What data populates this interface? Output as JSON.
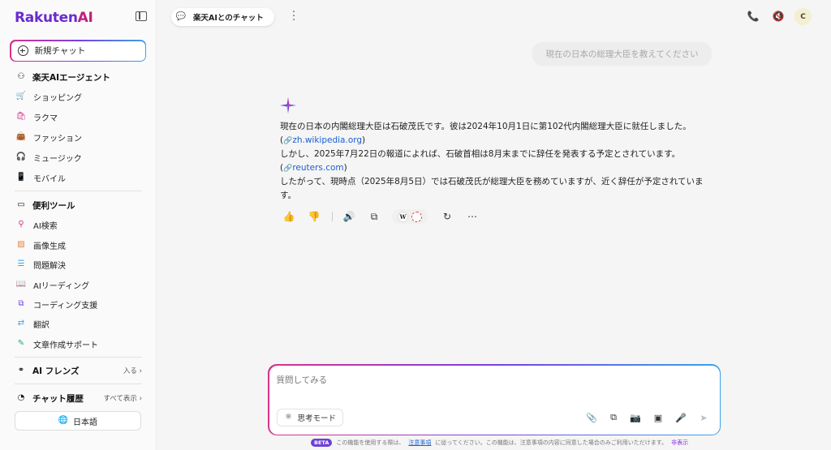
{
  "brand": {
    "logo_text": "Rakuten",
    "logo_ai": "AI"
  },
  "sidebar": {
    "new_chat": "新規チャット",
    "agent_section": "楽天AIエージェント",
    "agent_items": [
      "ショッピング",
      "ラクマ",
      "ファッション",
      "ミュージック",
      "モバイル"
    ],
    "tools_section": "便利ツール",
    "tool_items": [
      "AI検索",
      "画像生成",
      "問題解決",
      "AIリーディング",
      "コーディング支援",
      "翻訳",
      "文章作成サポート"
    ],
    "friends_section": "AI フレンズ",
    "friends_link": "入る ›",
    "history_section": "チャット履歴",
    "history_link": "すべて表示 ›",
    "language": "日本語"
  },
  "topbar": {
    "chat_title": "楽天AIとのチャット",
    "avatar_letter": "C"
  },
  "conversation": {
    "user_message": "現在の日本の総理大臣を教えてください",
    "answer_line1": "現在の日本の内閣総理大臣は石破茂氏です。彼は2024年10月1日に第102代内閣総理大臣に就任しました。",
    "cite1": "zh.wikipedia.org",
    "answer_line2": "しかし、2025年7月22日の報道によれば、石破首相は8月末までに辞任を発表する予定とされています。",
    "cite2": "reuters.com",
    "answer_line3": "したがって、現時点（2025年8月5日）では石破茂氏が総理大臣を務めていますが、近く辞任が予定されています。"
  },
  "composer": {
    "placeholder": "質問してみる",
    "think_mode": "思考モード"
  },
  "footer": {
    "beta": "BETA",
    "pre": "この機能を使用する際は、",
    "link": "注意事項",
    "post": "に従ってください。この機能は、注意事項の内容に同意した場合のみご利用いただけます。",
    "hide": "非表示"
  },
  "colors": {
    "brand_purple": "#6a2ad0",
    "brand_magenta": "#bf2080",
    "link": "#1a5fd0"
  }
}
